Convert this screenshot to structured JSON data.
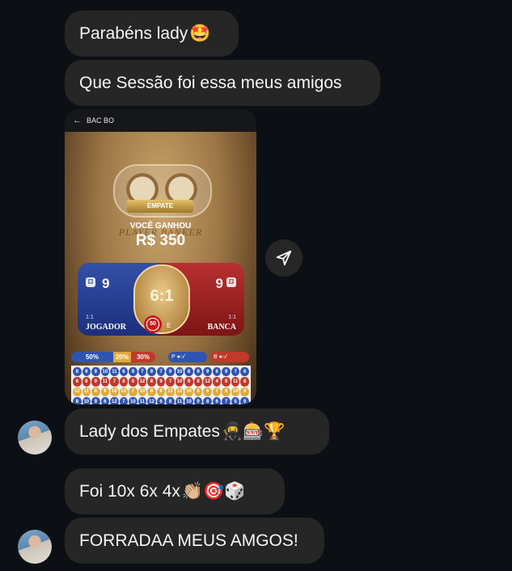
{
  "messages": [
    {
      "text": "Parabéns lady",
      "emoji": "🤩"
    },
    {
      "text": "Que Sessão foi essa meus amigos",
      "emoji": ""
    },
    {
      "text": "Lady dos Empates",
      "emoji": "🥷🎰🏆"
    },
    {
      "text": "Foi 10x 6x 4x",
      "emoji": "👏🏼🎯🎲"
    },
    {
      "text": "FORRADAA MEUS AMGOS!",
      "emoji": ""
    }
  ],
  "shared_image": {
    "header": {
      "back_icon": "arrow-left-icon",
      "title": "BAC BO"
    },
    "result_banner": "EMPATE",
    "win_label": "VOCÊ GANHOU",
    "win_amount": "R$ 350",
    "background_text": "PLAYER BANKER",
    "player": {
      "score": "9",
      "ratio": "1:1",
      "name": "JOGADOR"
    },
    "banker": {
      "score": "9",
      "ratio": "1:1",
      "name": "BANCA"
    },
    "tie": {
      "odds": "6:1",
      "chip_value": "50",
      "letters": "E E"
    },
    "percent": {
      "player": "50%",
      "tie": "20%",
      "banker": "30%"
    },
    "roads": {
      "player": "P",
      "banker": "B"
    },
    "history": [
      [
        "8",
        "9",
        "9",
        "10",
        "11",
        "6",
        "9",
        "7",
        "9",
        "7",
        "9",
        "10",
        "8",
        "9",
        "9",
        "6",
        "9",
        "7",
        "6"
      ],
      [
        "6",
        "8",
        "9",
        "11",
        "7",
        "8",
        "5",
        "12",
        "8",
        "9",
        "7",
        "10",
        "9",
        "8",
        "12",
        "4",
        "9",
        "11",
        "8"
      ],
      [
        "12",
        "11",
        "8",
        "9",
        "10",
        "12",
        "7",
        "10",
        "8",
        "9",
        "11",
        "12",
        "10",
        "8",
        "6",
        "7",
        "9",
        "10",
        "9"
      ],
      [
        "8",
        "10",
        "9",
        "6",
        "12",
        "7",
        "10",
        "11",
        "12",
        "6",
        "8",
        "11",
        "10",
        "9",
        "8",
        "6",
        "7",
        "5",
        "9"
      ],
      [
        "7",
        "6",
        "8",
        "10",
        "7",
        "7",
        "8",
        "9",
        "8",
        "8",
        "9",
        "10",
        "7",
        "8",
        "9",
        "7",
        "7",
        "8",
        "9"
      ],
      [
        "12",
        "9",
        "8",
        "12",
        "9",
        "10",
        "10",
        "8",
        "9",
        "5",
        "12",
        "9",
        "10",
        "8",
        "8",
        "6",
        "9",
        "10",
        "8"
      ]
    ],
    "colors": {
      "player": "#2f54b0",
      "banker": "#c0392b",
      "tie": "#e0a93a"
    }
  },
  "share_icon": "send-icon",
  "avatar_icon": "user-avatar"
}
